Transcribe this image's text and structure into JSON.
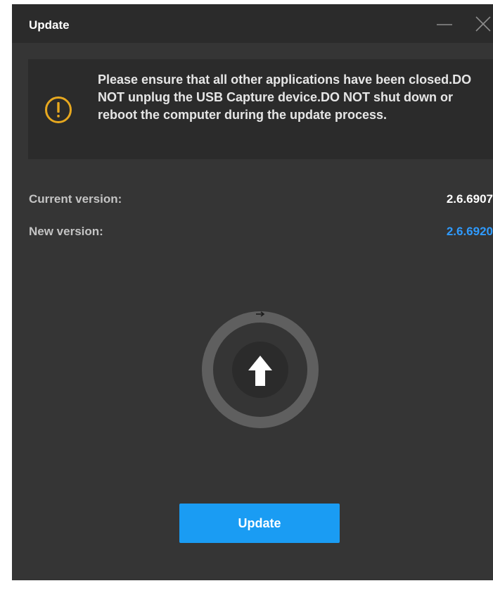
{
  "window": {
    "title": "Update"
  },
  "warning": {
    "icon": "exclamation-circle-icon",
    "icon_color": "#e7a81f",
    "message": "Please ensure that all other applications have been closed.DO NOT unplug the USB Capture device.DO NOT shut down or reboot the computer during the update process."
  },
  "versions": {
    "current_label": "Current version:",
    "current_value": "2.6.6907",
    "new_label": "New version:",
    "new_value": "2.6.6920",
    "new_value_color": "#2f9bff"
  },
  "progress": {
    "icon": "upload-arrow-icon",
    "value": 0
  },
  "actions": {
    "update_label": "Update",
    "button_color": "#1a9cf3"
  }
}
